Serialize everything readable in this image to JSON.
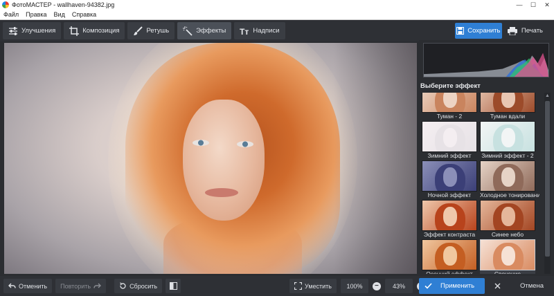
{
  "window": {
    "title": "ФотоМАСТЕР - wallhaven-94382.jpg",
    "controls": {
      "minimize": "—",
      "maximize": "☐",
      "close": "✕"
    }
  },
  "menu": {
    "items": [
      "Файл",
      "Правка",
      "Вид",
      "Справка"
    ]
  },
  "toolbar": {
    "tabs": [
      {
        "label": "Улучшения",
        "icon": "sliders-icon",
        "active": false
      },
      {
        "label": "Композиция",
        "icon": "crop-icon",
        "active": false
      },
      {
        "label": "Ретушь",
        "icon": "brush-icon",
        "active": false
      },
      {
        "label": "Эффекты",
        "icon": "magic-wand-icon",
        "active": true
      },
      {
        "label": "Надписи",
        "icon": "text-icon",
        "active": false
      }
    ],
    "save_label": "Сохранить",
    "print_label": "Печать"
  },
  "effects_panel": {
    "title": "Выберите эффект",
    "effects": [
      {
        "label": "Туман - 2",
        "hair": "#c9845e",
        "face": "#edd4c4"
      },
      {
        "label": "Туман вдали",
        "hair": "#9c4b2a",
        "face": "#e8c6b2"
      },
      {
        "label": "Зимний эффект",
        "hair": "#e7e2e6",
        "face": "#f4eef1"
      },
      {
        "label": "Зимний эффект - 2",
        "hair": "#c7e1e0",
        "face": "#f2f5f5"
      },
      {
        "label": "Ночной эффект",
        "hair": "#3b3f77",
        "face": "#8b8fb8"
      },
      {
        "label": "Холодное тонирование",
        "hair": "#8f6a5a",
        "face": "#e6d3c6"
      },
      {
        "label": "Эффект контраста",
        "hair": "#b8431c",
        "face": "#efc7ab"
      },
      {
        "label": "Синее небо",
        "hair": "#a34522",
        "face": "#e5b79b"
      },
      {
        "label": "Осенний эффект",
        "hair": "#c45e22",
        "face": "#f0c79f"
      },
      {
        "label": "Свечение",
        "hair": "#d98b61",
        "face": "#f6e1d5",
        "selected": true
      }
    ]
  },
  "bottombar": {
    "undo_label": "Отменить",
    "redo_label": "Повторить",
    "reset_label": "Сбросить",
    "fit_label": "Уместить",
    "zoom_100": "100%",
    "zoom_level": "43%",
    "zoom_out": "−",
    "zoom_in": "+",
    "apply_label": "Применить",
    "cancel_label": "Отмена"
  },
  "colors": {
    "accent": "#2f7fd4",
    "panel_bg": "#2b2d31",
    "toolbar_bg": "#2e3035"
  }
}
